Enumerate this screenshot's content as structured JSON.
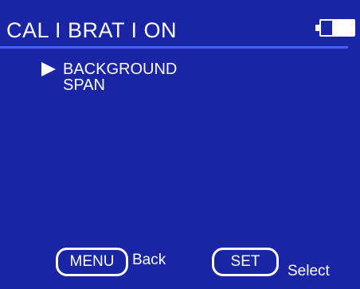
{
  "screen": {
    "title": "CALIBRATION",
    "background_color": "#1a25a5",
    "accent_color": "#3f63ff",
    "battery_icon": "battery-icon",
    "battery_level": 0.65
  },
  "menu": {
    "cursor_icon": "triangle-right-icon",
    "selected_index": 0,
    "items": [
      {
        "label": "BACKGROUND"
      },
      {
        "label": "SPAN"
      }
    ]
  },
  "softkeys": {
    "menu": {
      "key_label": "MENU",
      "action_label": "Back"
    },
    "set": {
      "key_label": "SET",
      "action_label": "Select"
    }
  }
}
